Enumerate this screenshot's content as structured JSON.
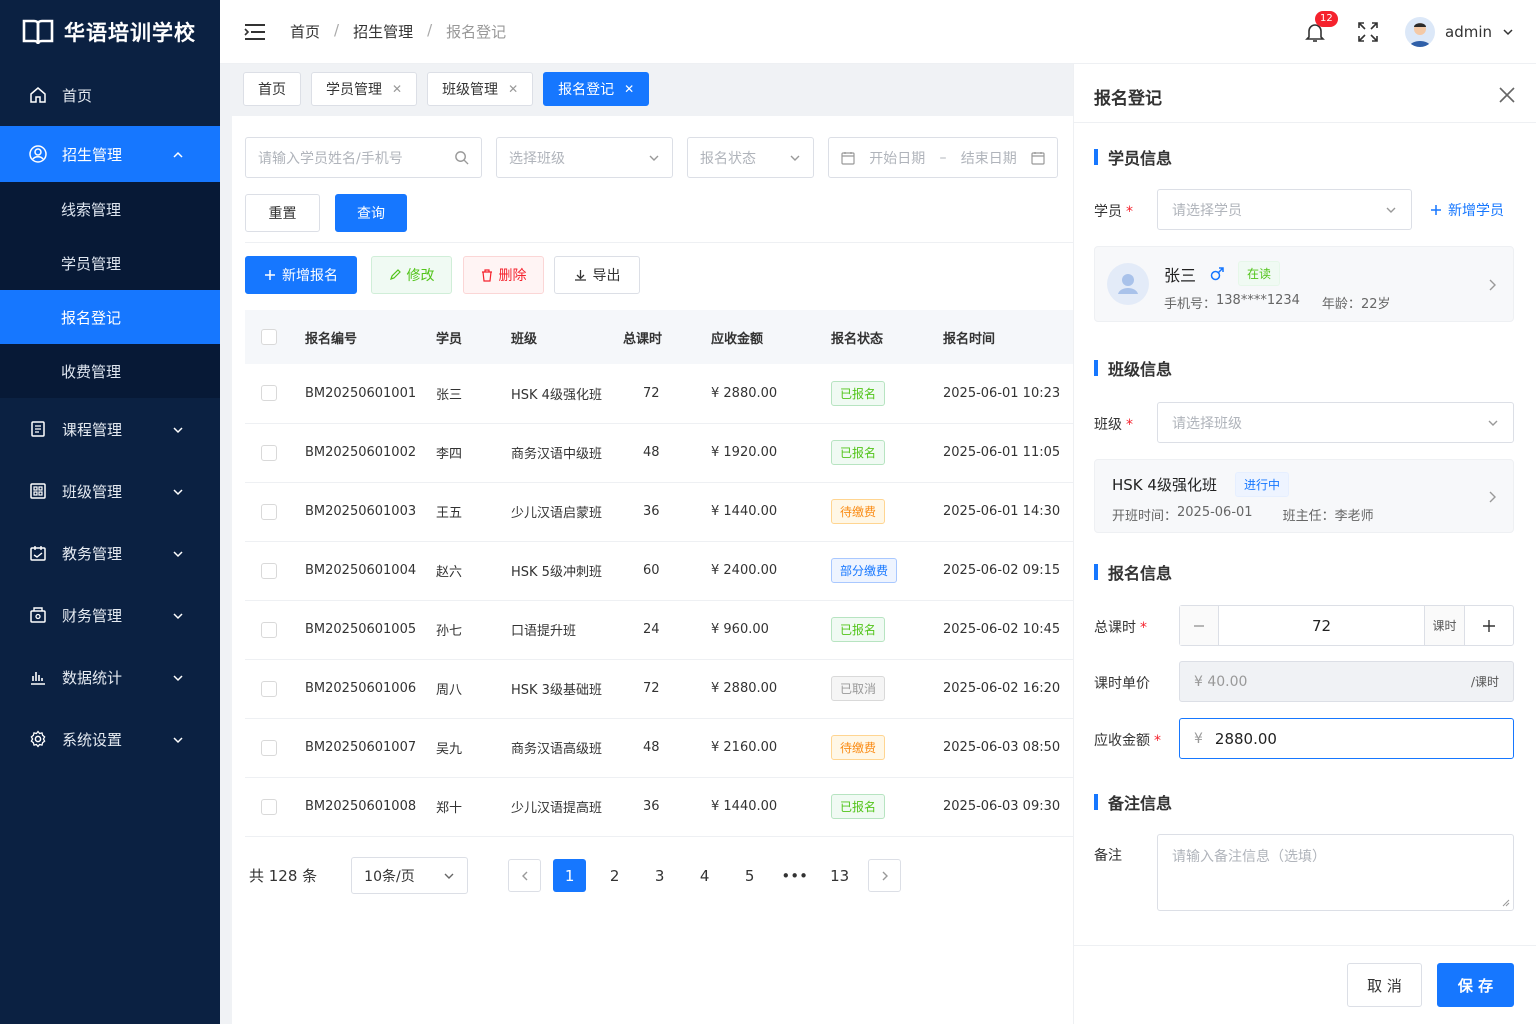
{
  "brand": {
    "name": "华语培训学校"
  },
  "nav": {
    "home": "首页",
    "enroll": "招生管理",
    "enroll_sub": [
      "线索管理",
      "学员管理",
      "报名登记",
      "收费管理"
    ],
    "course": "课程管理",
    "class": "班级管理",
    "teaching": "教务管理",
    "finance": "财务管理",
    "stats": "数据统计",
    "settings": "系统设置"
  },
  "header": {
    "breadcrumb": [
      "首页",
      "招生管理",
      "报名登记"
    ],
    "sep": "/",
    "notify_count": "12",
    "username": "admin"
  },
  "tabs": [
    "首页",
    "学员管理",
    "班级管理",
    "报名登记"
  ],
  "filters": {
    "search_placeholder": "请输入学员姓名/手机号",
    "class_placeholder": "选择班级",
    "status_placeholder": "报名状态",
    "start_date": "开始日期",
    "date_sep": "–",
    "end_date": "结束日期",
    "reset": "重置",
    "query": "查询"
  },
  "toolbar": {
    "add": "新增报名",
    "edit": "修改",
    "delete": "删除",
    "export": "导出"
  },
  "table": {
    "headers": [
      "报名编号",
      "学员",
      "班级",
      "总课时",
      "应收金额",
      "报名状态",
      "报名时间"
    ],
    "rows": [
      {
        "id": "BM20250601001",
        "student": "张三",
        "class": "HSK 4级强化班",
        "hours": "72",
        "amount": "¥ 2880.00",
        "status": "已报名",
        "time": "2025-06-01 10:23"
      },
      {
        "id": "BM20250601002",
        "student": "李四",
        "class": "商务汉语中级班",
        "hours": "48",
        "amount": "¥ 1920.00",
        "status": "已报名",
        "time": "2025-06-01 11:05"
      },
      {
        "id": "BM20250601003",
        "student": "王五",
        "class": "少儿汉语启蒙班",
        "hours": "36",
        "amount": "¥ 1440.00",
        "status": "待缴费",
        "time": "2025-06-01 14:30"
      },
      {
        "id": "BM20250601004",
        "student": "赵六",
        "class": "HSK 5级冲刺班",
        "hours": "60",
        "amount": "¥ 2400.00",
        "status": "部分缴费",
        "time": "2025-06-02 09:15"
      },
      {
        "id": "BM20250601005",
        "student": "孙七",
        "class": "口语提升班",
        "hours": "24",
        "amount": "¥ 960.00",
        "status": "已报名",
        "time": "2025-06-02 10:45"
      },
      {
        "id": "BM20250601006",
        "student": "周八",
        "class": "HSK 3级基础班",
        "hours": "72",
        "amount": "¥ 2880.00",
        "status": "已取消",
        "time": "2025-06-02 16:20"
      },
      {
        "id": "BM20250601007",
        "student": "吴九",
        "class": "商务汉语高级班",
        "hours": "48",
        "amount": "¥ 2160.00",
        "status": "待缴费",
        "time": "2025-06-03 08:50"
      },
      {
        "id": "BM20250601008",
        "student": "郑十",
        "class": "少儿汉语提高班",
        "hours": "36",
        "amount": "¥ 1440.00",
        "status": "已报名",
        "time": "2025-06-03 09:30"
      }
    ]
  },
  "status_colors": {
    "已报名": "#52c41a",
    "待缴费": "#fa8c16",
    "部分缴费": "#1677ff",
    "已取消": "#999999"
  },
  "pagination": {
    "total": "共 128 条",
    "page_size": "10条/页",
    "pages": [
      "1",
      "2",
      "3",
      "4",
      "5",
      "•••",
      "13"
    ],
    "current": "1"
  },
  "drawer": {
    "title": "报名登记",
    "student_section": "学员信息",
    "student_label": "学员",
    "student_placeholder": "请选择学员",
    "add_student": "新增学员",
    "student_card": {
      "name": "张三",
      "gender_icon": "male-icon",
      "status": "在读",
      "phone_label": "手机号：",
      "phone": "138****1234",
      "age_label": "年龄：",
      "age": "22岁"
    },
    "class_section": "班级信息",
    "class_label": "班级",
    "class_placeholder": "请选择班级",
    "class_card": {
      "name": "HSK 4级强化班",
      "status": "进行中",
      "start_label": "开班时间：",
      "start": "2025-06-01",
      "teacher_label": "班主任：",
      "teacher": "李老师"
    },
    "enroll_section": "报名信息",
    "hours_label": "总课时",
    "hours_value": "72",
    "hours_unit": "课时",
    "price_label": "课时单价",
    "price_value": "¥  40.00",
    "price_unit": "/课时",
    "amount_label": "应收金额",
    "amount_currency": "¥",
    "amount_value": "2880.00",
    "remark_section": "备注信息",
    "remark_label": "备注",
    "remark_placeholder": "请输入备注信息（选填）",
    "cancel": "取 消",
    "save": "保 存",
    "required_mark": "*"
  },
  "colors": {
    "primary": "#1677ff",
    "sidebar": "#0b2142",
    "danger": "#f5222d"
  }
}
